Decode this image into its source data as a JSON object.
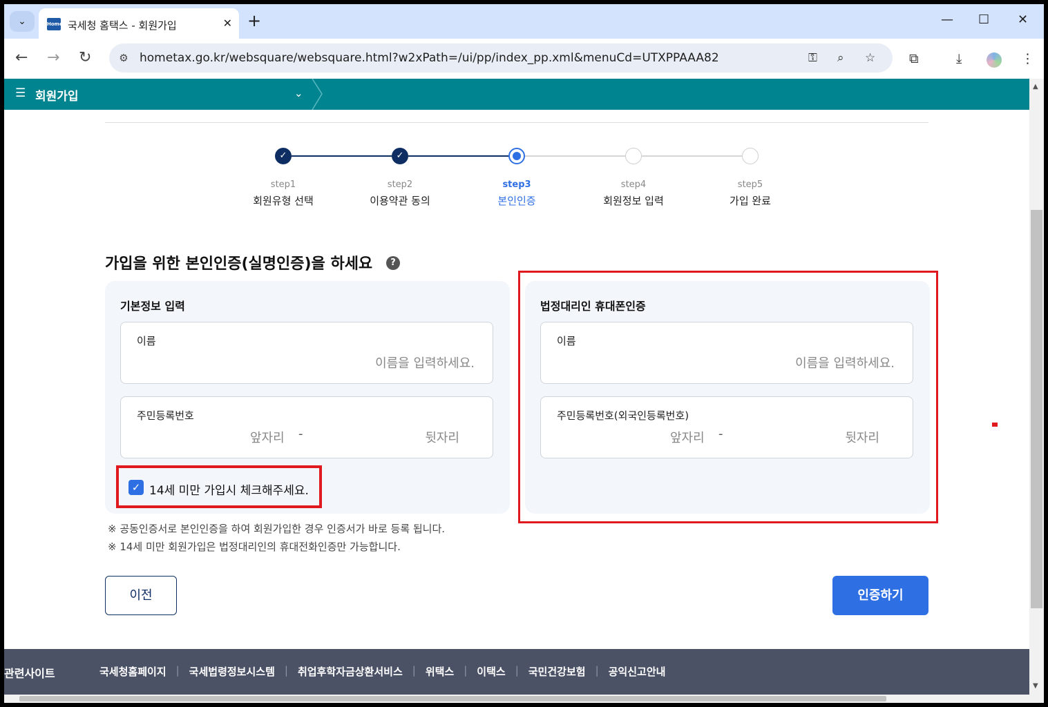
{
  "browser": {
    "tab_title": "국세청 홈택스 - 회원가입",
    "favicon_text": "Home",
    "url": "hometax.go.kr/websquare/websquare.html?w2xPath=/ui/pp/index_pp.xml&menuCd=UTXPPAAA82"
  },
  "header": {
    "title": "회원가입"
  },
  "steps": [
    {
      "num": "step1",
      "name": "회원유형 선택",
      "status": "done"
    },
    {
      "num": "step2",
      "name": "이용약관 동의",
      "status": "done"
    },
    {
      "num": "step3",
      "name": "본인인증",
      "status": "current"
    },
    {
      "num": "step4",
      "name": "회원정보 입력",
      "status": "todo"
    },
    {
      "num": "step5",
      "name": "가입 완료",
      "status": "todo"
    }
  ],
  "main": {
    "title": "가입을 위한 본인인증(실명인증)을 하세요",
    "help": "?",
    "basic_card": {
      "title": "기본정보 입력",
      "name_label": "이름",
      "name_placeholder": "이름을 입력하세요.",
      "rrn_label": "주민등록번호",
      "rrn_front": "앞자리",
      "rrn_dash": "-",
      "rrn_back": "뒷자리"
    },
    "guardian_card": {
      "title": "법정대리인 휴대폰인증",
      "name_label": "이름",
      "name_placeholder": "이름을 입력하세요.",
      "rrn_label": "주민등록번호(외국인등록번호)",
      "rrn_front": "앞자리",
      "rrn_dash": "-",
      "rrn_back": "뒷자리"
    },
    "under14_label": "14세 미만 가입시 체크해주세요.",
    "under14_checked": true,
    "notes": [
      "※ 공동인증서로 본인인증을 하여 회원가입한 경우 인증서가 바로 등록 됩니다.",
      "※ 14세 미만 회원가입은 법정대리인의 휴대전화인증만 가능합니다."
    ],
    "prev_button": "이전",
    "auth_button": "인증하기"
  },
  "footer": {
    "title": "관련사이트",
    "links": [
      "국세청홈페이지",
      "국세법령정보시스템",
      "취업후학자금상환서비스",
      "위택스",
      "이택스",
      "국민건강보험",
      "공익신고안내"
    ]
  },
  "colors": {
    "header_bg": "#00848f",
    "primary": "#2f6fe4",
    "done_step": "#0e2e63",
    "highlight": "#e0191f",
    "footer_bg": "#4b5266"
  }
}
